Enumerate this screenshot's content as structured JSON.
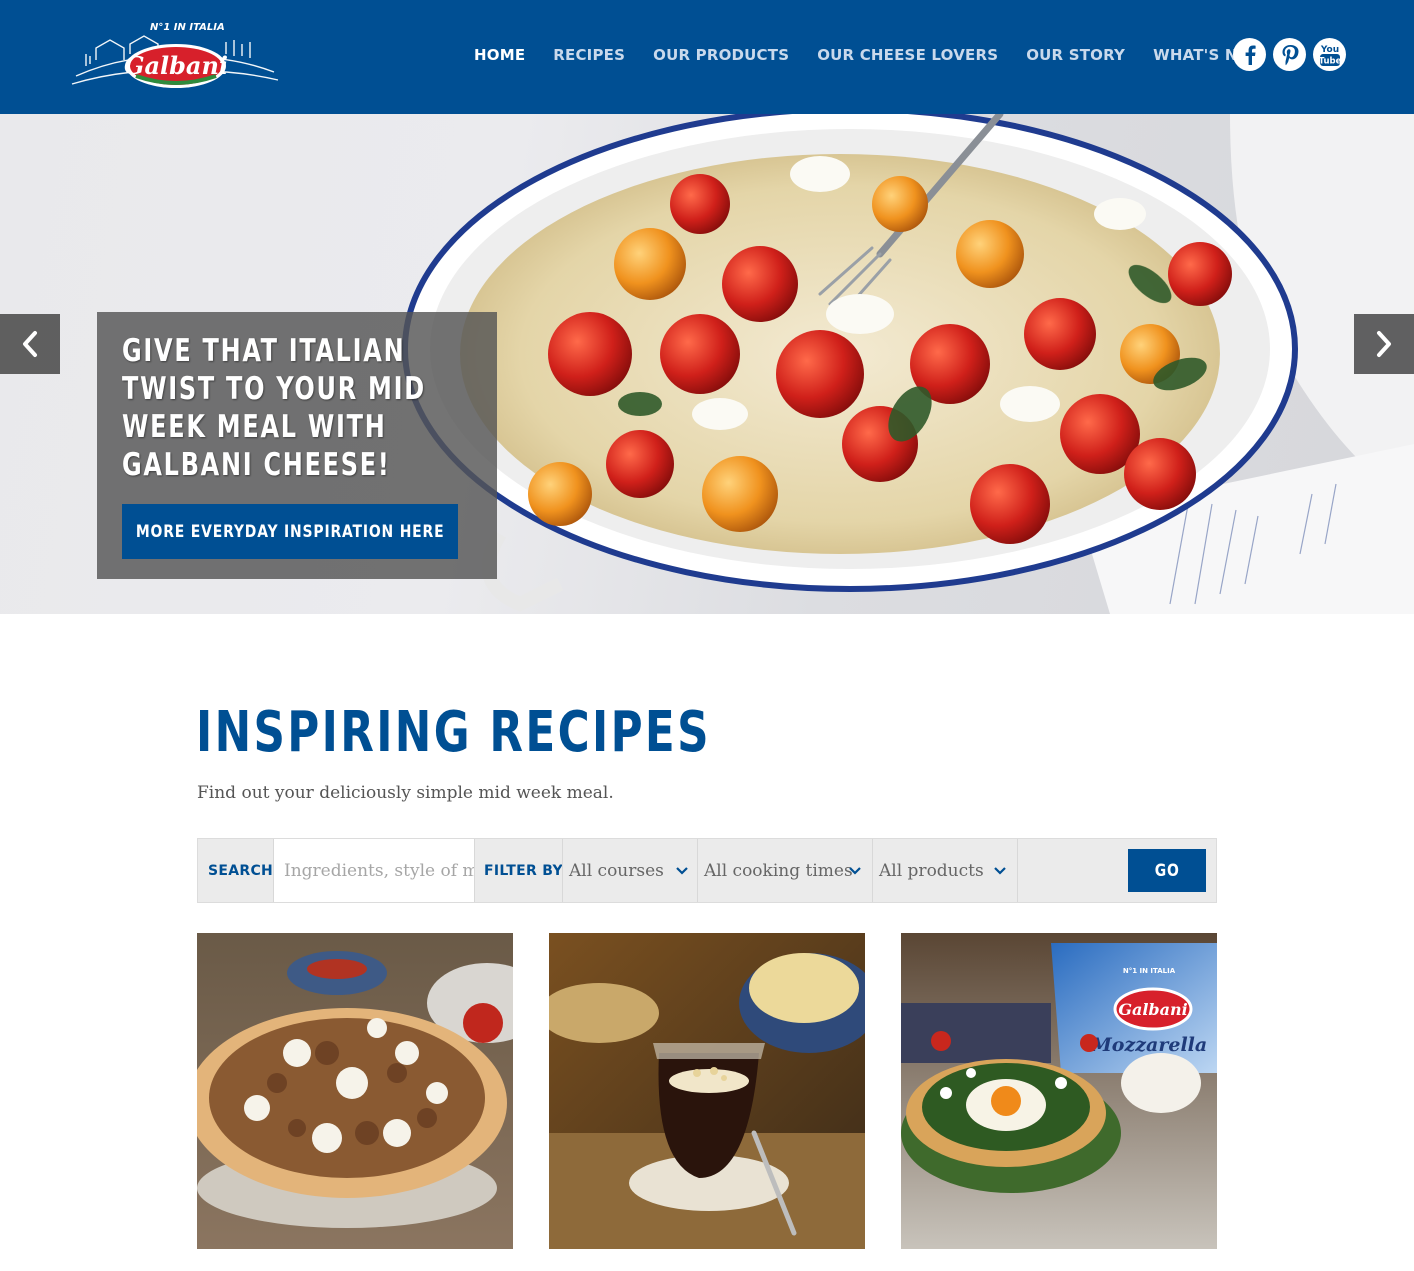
{
  "header": {
    "logo": {
      "brand": "Galbani",
      "tagline": "N°1 IN ITALIA"
    },
    "nav": [
      {
        "label": "HOME",
        "active": true
      },
      {
        "label": "RECIPES",
        "active": false
      },
      {
        "label": "OUR PRODUCTS",
        "active": false
      },
      {
        "label": "OUR CHEESE LOVERS",
        "active": false
      },
      {
        "label": "OUR STORY",
        "active": false
      },
      {
        "label": "WHAT'S NEW",
        "active": false
      }
    ],
    "social": [
      {
        "icon": "facebook-icon"
      },
      {
        "icon": "pinterest-icon"
      },
      {
        "icon": "youtube-icon",
        "text_top": "You",
        "text_bottom": "Tube"
      }
    ]
  },
  "hero": {
    "title": "GIVE THAT ITALIAN TWIST TO YOUR MID WEEK MEAL WITH GALBANI CHEESE!",
    "button_label": "MORE EVERYDAY INSPIRATION HERE",
    "prev_icon": "chevron-left-icon",
    "next_icon": "chevron-right-icon"
  },
  "recipes": {
    "title": "INSPIRING RECIPES",
    "subtitle": "Find out your deliciously simple mid week meal.",
    "filter": {
      "search_label": "SEARCH",
      "search_placeholder": "Ingredients, style of meal...",
      "filter_label": "FILTER BY",
      "courses": "All courses",
      "times": "All cooking times",
      "products": "All products",
      "go_label": "GO"
    },
    "cards": [
      {
        "image": "pizza with ricotta"
      },
      {
        "image": "chocolate dessert in jar"
      },
      {
        "image": "spinach and egg tart with Galbani Mozzarella"
      }
    ],
    "card3_package": {
      "brand": "Galbani",
      "product": "Mozzarella",
      "tagline": "N°1 IN ITALIA"
    }
  },
  "colors": {
    "brand_blue": "#004f93",
    "brand_red": "#d7202b",
    "nav_inactive": "#c9d9ec"
  }
}
